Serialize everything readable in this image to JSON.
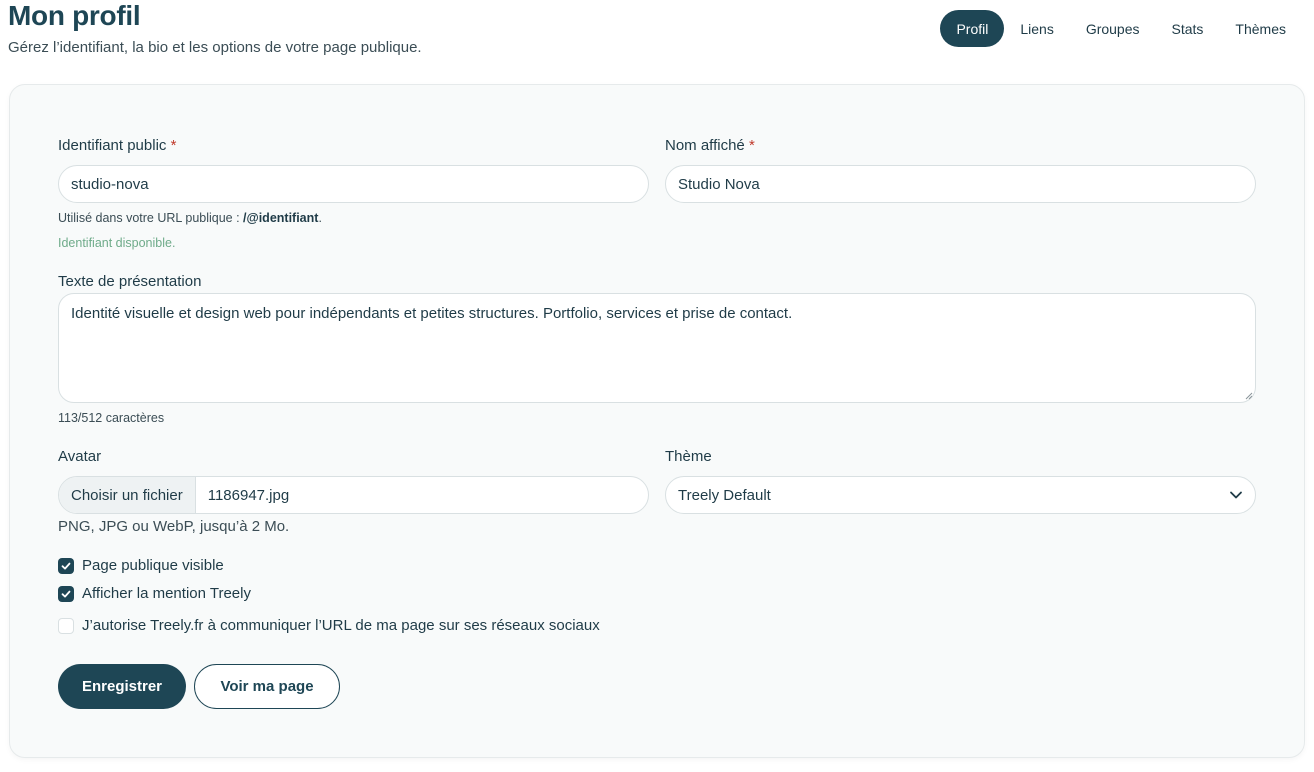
{
  "header": {
    "title": "Mon profil",
    "subtitle": "Gérez l’identifiant, la bio et les options de votre page publique."
  },
  "tabs": [
    {
      "label": "Profil",
      "active": true
    },
    {
      "label": "Liens",
      "active": false
    },
    {
      "label": "Groupes",
      "active": false
    },
    {
      "label": "Stats",
      "active": false
    },
    {
      "label": "Thèmes",
      "active": false
    }
  ],
  "form": {
    "username": {
      "label": "Identifiant public",
      "required_mark": "*",
      "value": "studio-nova",
      "hint_prefix": "Utilisé dans votre URL publique : ",
      "hint_path": "/@identifiant",
      "hint_suffix": ".",
      "status": "Identifiant disponible."
    },
    "display_name": {
      "label": "Nom affiché",
      "required_mark": "*",
      "value": "Studio Nova"
    },
    "bio": {
      "label": "Texte de présentation",
      "value": "Identité visuelle et design web pour indépendants et petites structures. Portfolio, services et prise de contact.",
      "counter": "113/512 caractères"
    },
    "avatar": {
      "label": "Avatar",
      "button": "Choisir un fichier",
      "file_name": "1186947.jpg",
      "hint": "PNG, JPG ou WebP, jusqu’à 2 Mo."
    },
    "theme": {
      "label": "Thème",
      "selected": "Treely Default"
    },
    "options": [
      {
        "label": "Page publique visible",
        "checked": true
      },
      {
        "label": "Afficher la mention Treely",
        "checked": true
      },
      {
        "label": "J’autorise Treely.fr à communiquer l’URL de ma page sur ses réseaux sociaux",
        "checked": false
      }
    ],
    "save_label": "Enregistrer",
    "view_label": "Voir ma page"
  },
  "colors": {
    "primary": "#1e4655",
    "success": "#6fab8a",
    "required": "#c0392b"
  }
}
